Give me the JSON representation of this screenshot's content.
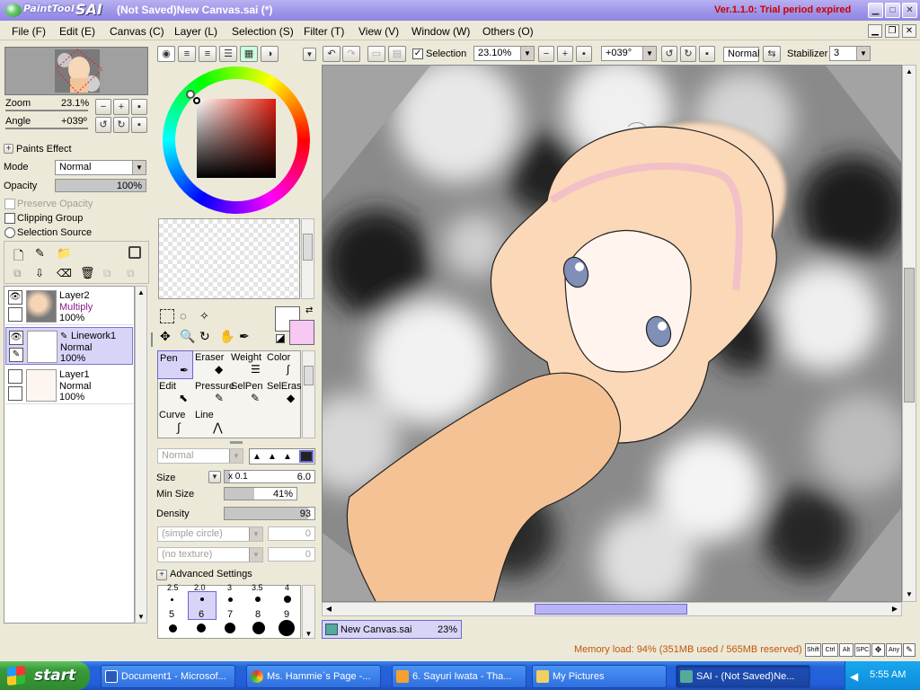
{
  "app": {
    "logo_small": "PaintTool",
    "logo_big": "SAI",
    "title": "(Not Saved)New Canvas.sai (*)",
    "version": "Ver.1.1.0: Trial period expired"
  },
  "menu": [
    "File (F)",
    "Edit (E)",
    "Canvas (C)",
    "Layer (L)",
    "Selection (S)",
    "Filter (T)",
    "View (V)",
    "Window (W)",
    "Others (O)"
  ],
  "navigator": {
    "zoom_label": "Zoom",
    "zoom_value": "23.1%",
    "angle_label": "Angle",
    "angle_value": "+039º"
  },
  "layer_props": {
    "paints_effect": "Paints Effect",
    "mode_label": "Mode",
    "mode_value": "Normal",
    "opacity_label": "Opacity",
    "opacity_value": "100%",
    "preserve_opacity": "Preserve Opacity",
    "clipping_group": "Clipping Group",
    "selection_source": "Selection Source"
  },
  "layers": [
    {
      "name": "Layer2",
      "mode": "Multiply",
      "opacity": "100%"
    },
    {
      "name": "Linework1",
      "mode": "Normal",
      "opacity": "100%"
    },
    {
      "name": "Layer1",
      "mode": "Normal",
      "opacity": "100%"
    }
  ],
  "tools": {
    "row1": [
      {
        "name": "Pen"
      },
      {
        "name": "Eraser"
      },
      {
        "name": "Weight"
      },
      {
        "name": "Color"
      }
    ],
    "row2": [
      {
        "name": "Edit"
      },
      {
        "name": "Pressure"
      },
      {
        "name": "SelPen"
      },
      {
        "name": "SelEras"
      }
    ],
    "row3": [
      {
        "name": "Curve"
      },
      {
        "name": "Line"
      }
    ]
  },
  "brush": {
    "blend_mode": "Normal",
    "size_label": "Size",
    "size_mult": "x 0.1",
    "size_value": "6.0",
    "min_size_label": "Min Size",
    "min_size_value": "41%",
    "min_size_level": 41,
    "density_label": "Density",
    "density_value": "93",
    "density_level": 93,
    "shape": "(simple circle)",
    "shape_value": "0",
    "texture": "(no texture)",
    "texture_value": "0",
    "advanced": "Advanced Settings"
  },
  "brush_sizes": {
    "top_row": [
      "2.5",
      "2.0",
      "3",
      "3.5",
      "4"
    ],
    "mid_row": [
      "5",
      "6",
      "7",
      "8",
      "9"
    ],
    "selected": "6"
  },
  "toolbar": {
    "selection_label": "Selection",
    "zoom_value": "23.10%",
    "angle_value": "+039°",
    "mode_value": "Normal",
    "stabilizer_label": "Stabilizer",
    "stabilizer_value": "3"
  },
  "canvas_tab": {
    "name": "New Canvas.sai",
    "zoom": "23%"
  },
  "status": {
    "memory": "Memory load: 94% (351MB used / 565MB reserved)",
    "keys": [
      "Shift",
      "Ctrl",
      "Alt",
      "SPC",
      "Any"
    ]
  },
  "taskbar": {
    "start": "start",
    "tasks": [
      "Document1 - Microsof...",
      "Ms. Hammie`s Page -...",
      "6. Sayuri Iwata - Tha...",
      "My Pictures",
      "SAI - (Not Saved)Ne..."
    ],
    "clock": "5:55 AM"
  },
  "colors": {
    "title_bar": "#9c94e8",
    "accent_select": "#d7d4f8",
    "secondary_color": "#f7c8f4",
    "memory_text": "#c0560a"
  }
}
